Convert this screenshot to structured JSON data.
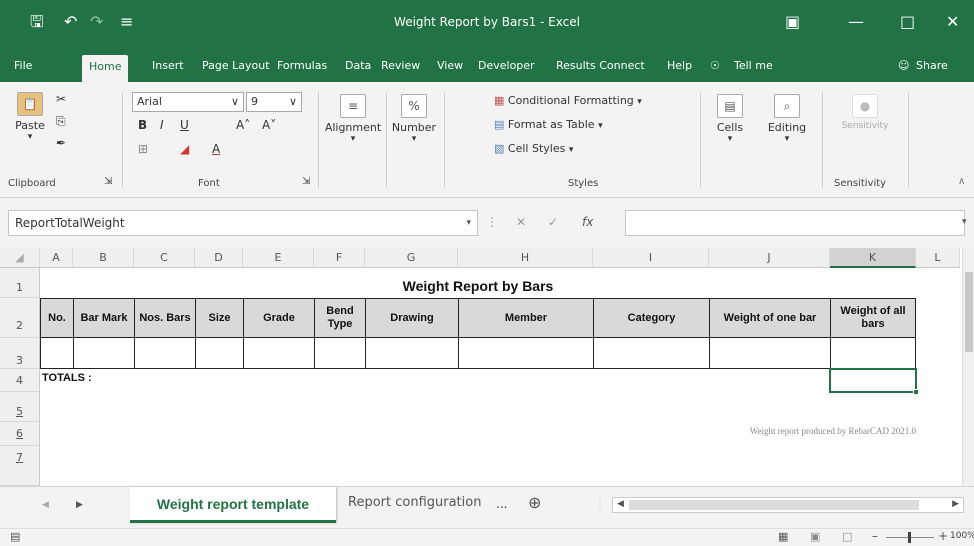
{
  "window": {
    "title": "Weight Report by Bars1  -  Excel"
  },
  "ribbon_tabs": [
    "File",
    "Home",
    "Insert",
    "Page Layout",
    "Formulas",
    "Data",
    "Review",
    "View",
    "Developer",
    "Results Connect",
    "Help",
    "Tell me",
    "Share"
  ],
  "ribbon": {
    "clipboard": {
      "paste": "Paste",
      "label": "Clipboard"
    },
    "font": {
      "name": "Arial",
      "size": "9",
      "label": "Font"
    },
    "alignment": "Alignment",
    "number": "Number",
    "styles": {
      "conditional": "Conditional Formatting",
      "format_table": "Format as Table",
      "cell_styles": "Cell Styles",
      "label": "Styles"
    },
    "cells": "Cells",
    "editing": "Editing",
    "sensitivity": {
      "button": "Sensitivity",
      "label": "Sensitivity"
    }
  },
  "formula_bar": {
    "name_box": "ReportTotalWeight",
    "fx": "fx"
  },
  "columns": [
    "A",
    "B",
    "C",
    "D",
    "E",
    "F",
    "G",
    "H",
    "I",
    "J",
    "K",
    "L"
  ],
  "rows": [
    "1",
    "2",
    "3",
    "4",
    "5",
    "6",
    "7"
  ],
  "sheet": {
    "title": "Weight Report by Bars",
    "headers": [
      "No.",
      "Bar Mark",
      "Nos. Bars",
      "Size",
      "Grade",
      "Bend Type",
      "Drawing",
      "Member",
      "Category",
      "Weight of one bar",
      "Weight of all bars"
    ],
    "totals_label": "TOTALS :",
    "footer_note": "Weight report produced by RebarCAD 2021.0"
  },
  "sheet_tabs": {
    "active": "Weight report template",
    "other": "Report configuration",
    "more": "..."
  },
  "status": {
    "zoom": "100%"
  },
  "colors": {
    "excel_green": "#217346",
    "header_fill": "#d9d9d9",
    "selection": "#217346"
  }
}
